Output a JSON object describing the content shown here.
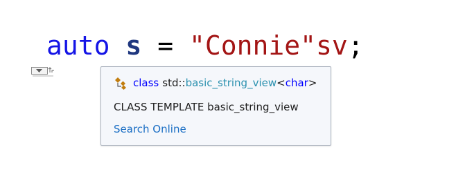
{
  "code": {
    "keyword": "auto",
    "variable": "s",
    "operator": "=",
    "string_literal": "\"Connie\"",
    "suffix": "sv",
    "terminator": ";"
  },
  "colors": {
    "keyword": "#1515e6",
    "variable": "#1f377f",
    "string": "#a31515",
    "tooltip_bg": "#f5f7fb",
    "tooltip_border": "#a9b1bd",
    "link": "#1a6ec4",
    "type_name": "#2b91af"
  },
  "quick_action": {
    "icon": "quick-action-icon"
  },
  "tooltip": {
    "icon": "class-icon",
    "signature": {
      "keyword": "class",
      "namespace": "std::",
      "type_name": "basic_string_view",
      "open": "<",
      "template_arg": "char",
      "close": ">"
    },
    "description": "CLASS TEMPLATE basic_string_view",
    "link_label": "Search Online"
  }
}
